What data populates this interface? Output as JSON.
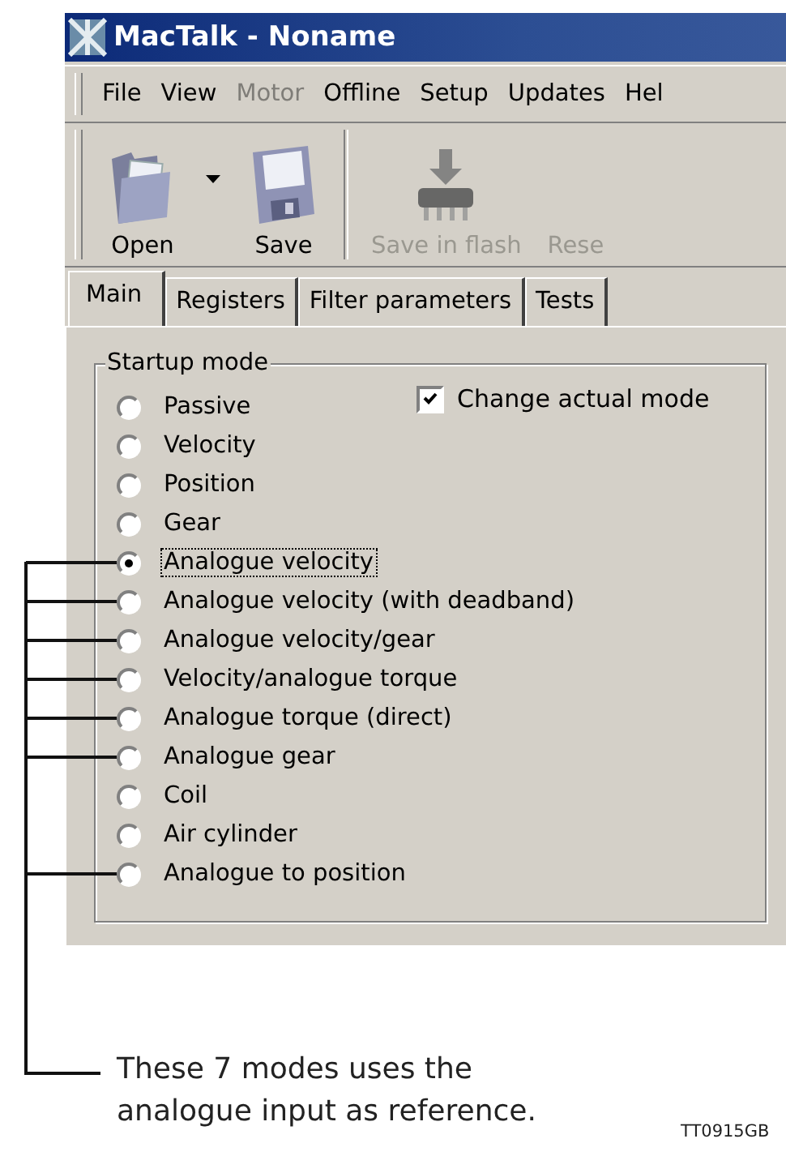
{
  "window": {
    "title": "MacTalk - Noname"
  },
  "menu": [
    {
      "label": "File",
      "disabled": false
    },
    {
      "label": "View",
      "disabled": false
    },
    {
      "label": "Motor",
      "disabled": true
    },
    {
      "label": "Offline",
      "disabled": false
    },
    {
      "label": "Setup",
      "disabled": false
    },
    {
      "label": "Updates",
      "disabled": false
    },
    {
      "label": "Hel",
      "disabled": false
    }
  ],
  "toolbar": [
    {
      "kind": "folder",
      "label": "Open",
      "disabled": false
    },
    {
      "kind": "dropdown"
    },
    {
      "kind": "floppy",
      "label": "Save",
      "disabled": false
    },
    {
      "kind": "separator"
    },
    {
      "kind": "chip",
      "label": "Save in flash",
      "disabled": true
    },
    {
      "kind": "blank",
      "label": "Rese",
      "disabled": true
    }
  ],
  "tabs": [
    {
      "label": "Main",
      "selected": true
    },
    {
      "label": "Registers",
      "selected": false
    },
    {
      "label": "Filter parameters",
      "selected": false
    },
    {
      "label": "Tests",
      "selected": false
    }
  ],
  "startup_mode": {
    "title": "Startup mode",
    "checkbox": {
      "label": "Change actual mode",
      "checked": true
    },
    "modes": [
      {
        "label": "Passive",
        "selected": false,
        "annotated": false
      },
      {
        "label": "Velocity",
        "selected": false,
        "annotated": false
      },
      {
        "label": "Position",
        "selected": false,
        "annotated": false
      },
      {
        "label": "Gear",
        "selected": false,
        "annotated": false
      },
      {
        "label": "Analogue velocity",
        "selected": true,
        "annotated": true
      },
      {
        "label": "Analogue velocity (with deadband)",
        "selected": false,
        "annotated": true
      },
      {
        "label": "Analogue velocity/gear",
        "selected": false,
        "annotated": true
      },
      {
        "label": "Velocity/analogue torque",
        "selected": false,
        "annotated": true
      },
      {
        "label": "Analogue torque (direct)",
        "selected": false,
        "annotated": true
      },
      {
        "label": "Analogue gear",
        "selected": false,
        "annotated": true
      },
      {
        "label": "Coil",
        "selected": false,
        "annotated": false
      },
      {
        "label": "Air cylinder",
        "selected": false,
        "annotated": false
      },
      {
        "label": "Analogue to position",
        "selected": false,
        "annotated": true
      }
    ]
  },
  "annotation": {
    "caption": "These 7 modes uses the analogue input as reference.",
    "figure_code": "TT0915GB"
  }
}
